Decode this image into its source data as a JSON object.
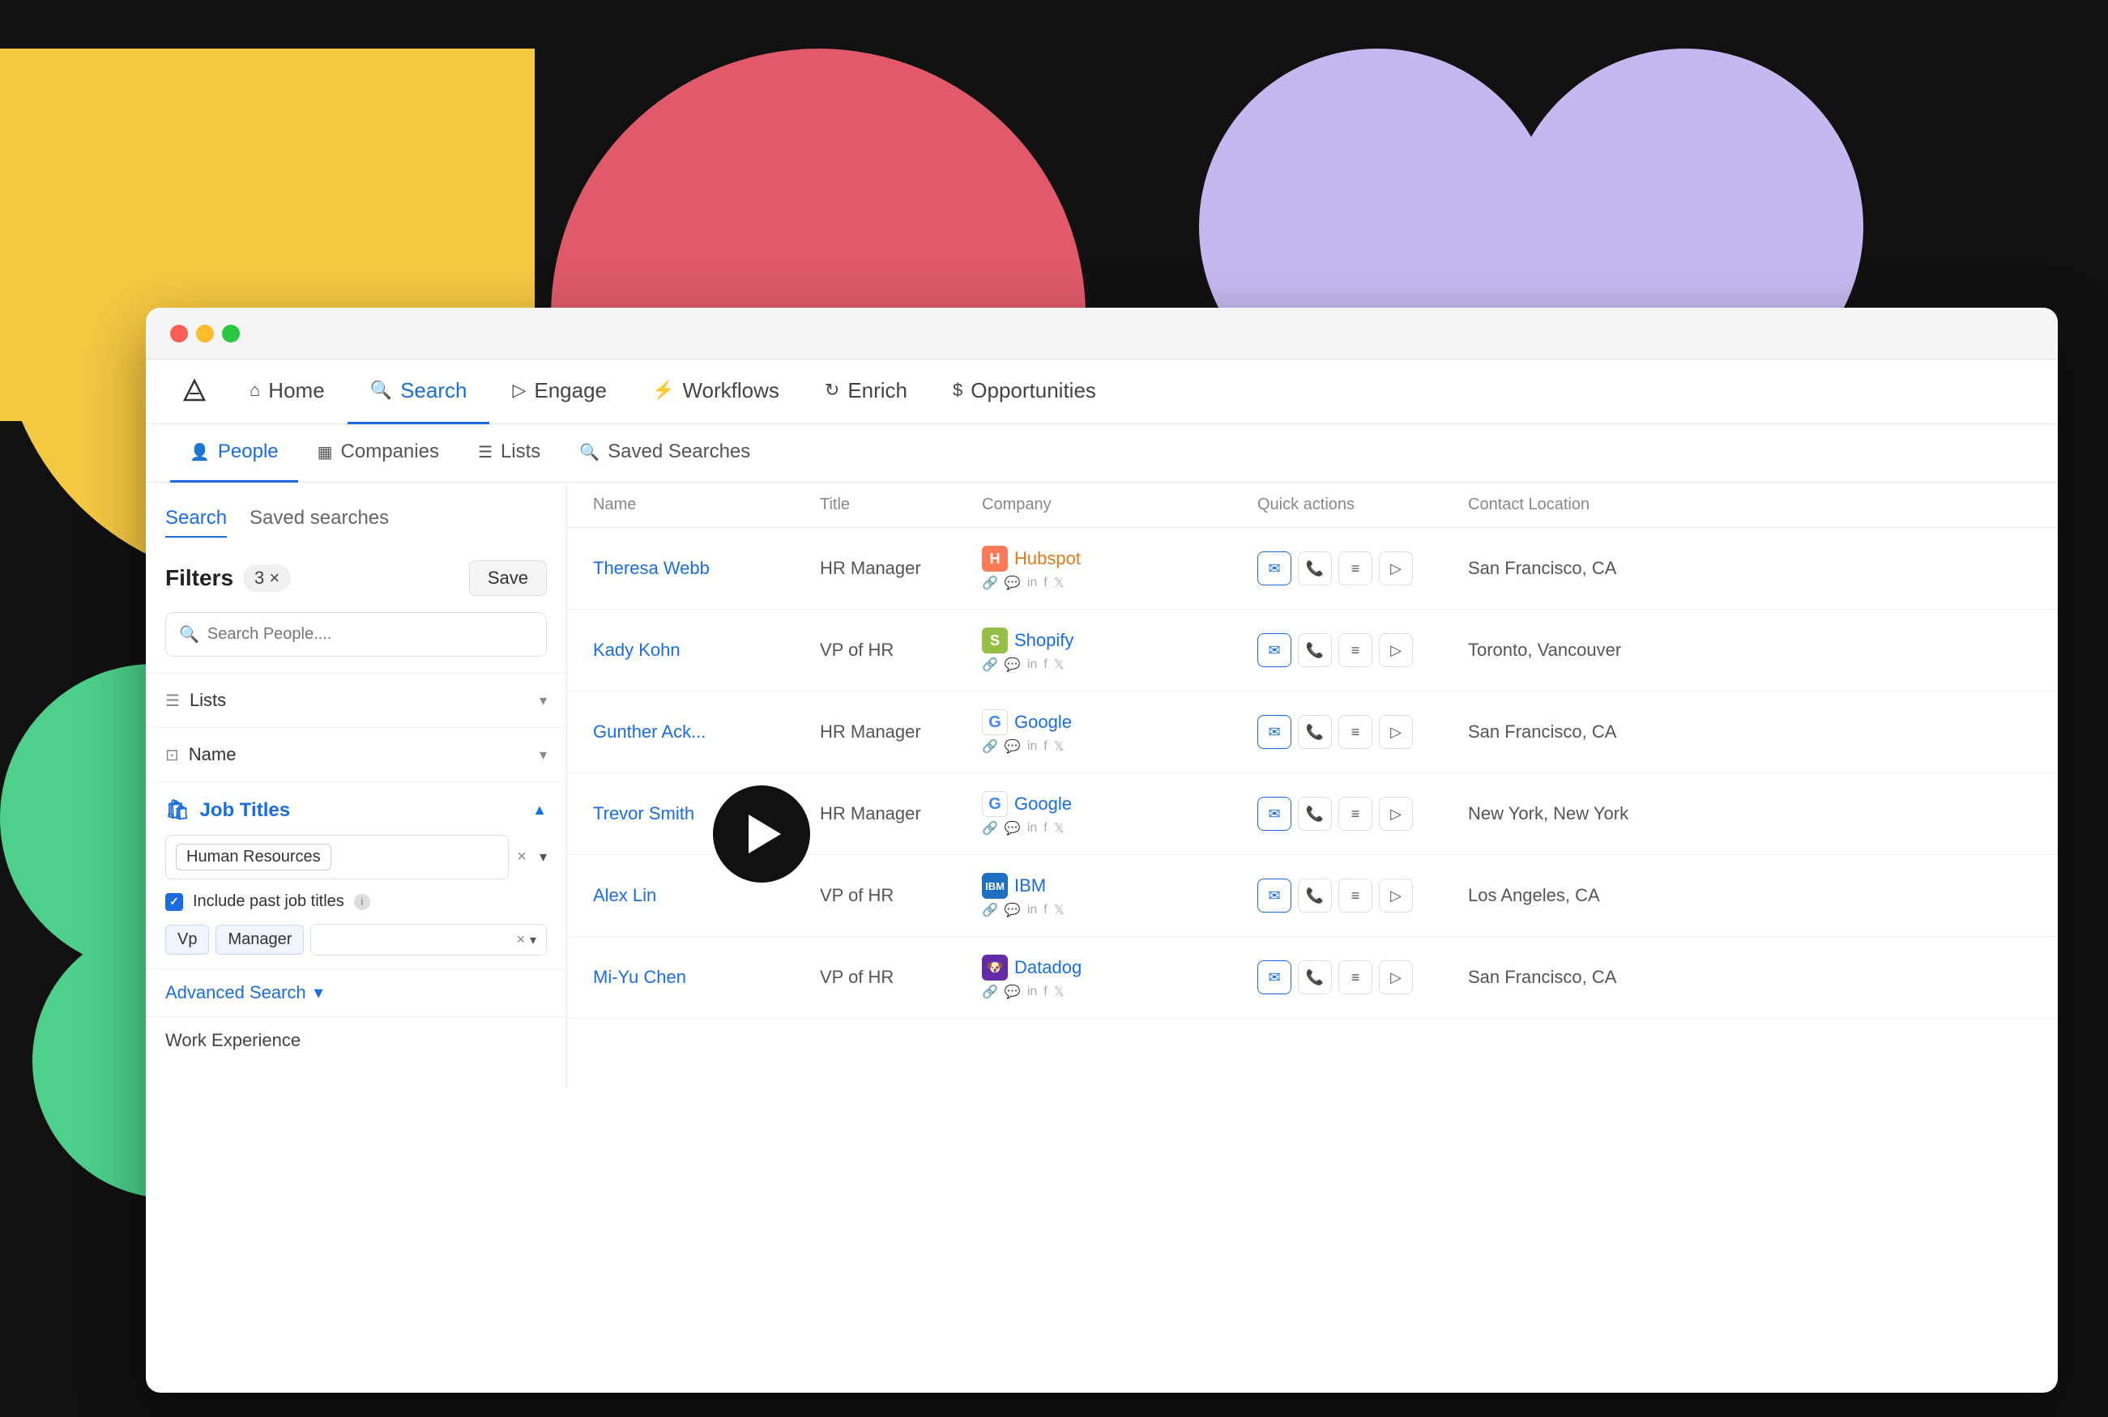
{
  "background": {
    "shapes": [
      "yellow",
      "pink",
      "purple1",
      "purple2",
      "purple3",
      "green1",
      "green2"
    ]
  },
  "window": {
    "traffic_lights": [
      "red",
      "yellow",
      "green"
    ]
  },
  "nav": {
    "logo_icon": "apollo-icon",
    "items": [
      {
        "label": "Home",
        "icon": "home-icon",
        "active": false
      },
      {
        "label": "Search",
        "icon": "search-icon",
        "active": true
      },
      {
        "label": "Engage",
        "icon": "engage-icon",
        "active": false
      },
      {
        "label": "Workflows",
        "icon": "workflows-icon",
        "active": false
      },
      {
        "label": "Enrich",
        "icon": "enrich-icon",
        "active": false
      },
      {
        "label": "Opportunities",
        "icon": "opportunities-icon",
        "active": false
      }
    ]
  },
  "sub_tabs": [
    {
      "label": "People",
      "icon": "people-icon",
      "active": true
    },
    {
      "label": "Companies",
      "icon": "companies-icon",
      "active": false
    },
    {
      "label": "Lists",
      "icon": "lists-icon",
      "active": false
    },
    {
      "label": "Saved Searches",
      "icon": "saved-searches-icon",
      "active": false
    }
  ],
  "left_panel": {
    "tabs": [
      {
        "label": "Search",
        "active": true
      },
      {
        "label": "Saved searches",
        "active": false
      }
    ],
    "filters": {
      "title": "Filters",
      "count": "3 ×",
      "save_label": "Save"
    },
    "search_placeholder": "Search People....",
    "filter_rows": [
      {
        "label": "Lists",
        "icon": "list-icon"
      },
      {
        "label": "Name",
        "icon": "name-icon"
      }
    ],
    "job_titles": {
      "label": "Job Titles",
      "tag_input": {
        "value": "Human Resources",
        "clear_icon": "×",
        "dropdown_icon": "▾"
      },
      "include_past": {
        "checked": true,
        "label": "Include past job titles",
        "info_icon": "ℹ"
      },
      "tags": [
        "Vp",
        "Manager"
      ],
      "tags_clear": "×",
      "tags_dropdown": "▾"
    },
    "advanced_search": {
      "label": "Advanced Search",
      "icon": "▾"
    },
    "work_experience": {
      "label": "Work Experience"
    }
  },
  "table": {
    "headers": [
      "Name",
      "Title",
      "Company",
      "Quick actions",
      "Contact Location"
    ],
    "rows": [
      {
        "name": "Theresa Webb",
        "title": "HR Manager",
        "company": "Hubspot",
        "company_type": "hubspot",
        "links": [
          "link",
          "chat",
          "linkedin",
          "facebook",
          "twitter"
        ],
        "location": "San Francisco, CA"
      },
      {
        "name": "Kady Kohn",
        "title": "VP of HR",
        "company": "Shopify",
        "company_type": "shopify",
        "links": [
          "link",
          "chat",
          "linkedin",
          "facebook",
          "twitter"
        ],
        "location": "Toronto, Vancouver"
      },
      {
        "name": "Gunther Ack...",
        "title": "HR Manager",
        "company": "Google",
        "company_type": "google",
        "links": [
          "link",
          "chat",
          "linkedin",
          "facebook",
          "twitter"
        ],
        "location": "San Francisco, CA"
      },
      {
        "name": "Trevor Smith",
        "title": "HR Manager",
        "company": "Google",
        "company_type": "google",
        "links": [
          "link",
          "chat",
          "linkedin",
          "facebook",
          "twitter"
        ],
        "location": "New York, New York"
      },
      {
        "name": "Alex Lin",
        "title": "VP of HR",
        "company": "IBM",
        "company_type": "ibm",
        "links": [
          "link",
          "chat",
          "linkedin",
          "facebook",
          "twitter"
        ],
        "location": "Los Angeles, CA"
      },
      {
        "name": "Mi-Yu Chen",
        "title": "VP of HR",
        "company": "Datadog",
        "company_type": "datadog",
        "links": [
          "link",
          "chat",
          "linkedin",
          "facebook",
          "twitter"
        ],
        "location": "San Francisco, CA"
      }
    ]
  }
}
